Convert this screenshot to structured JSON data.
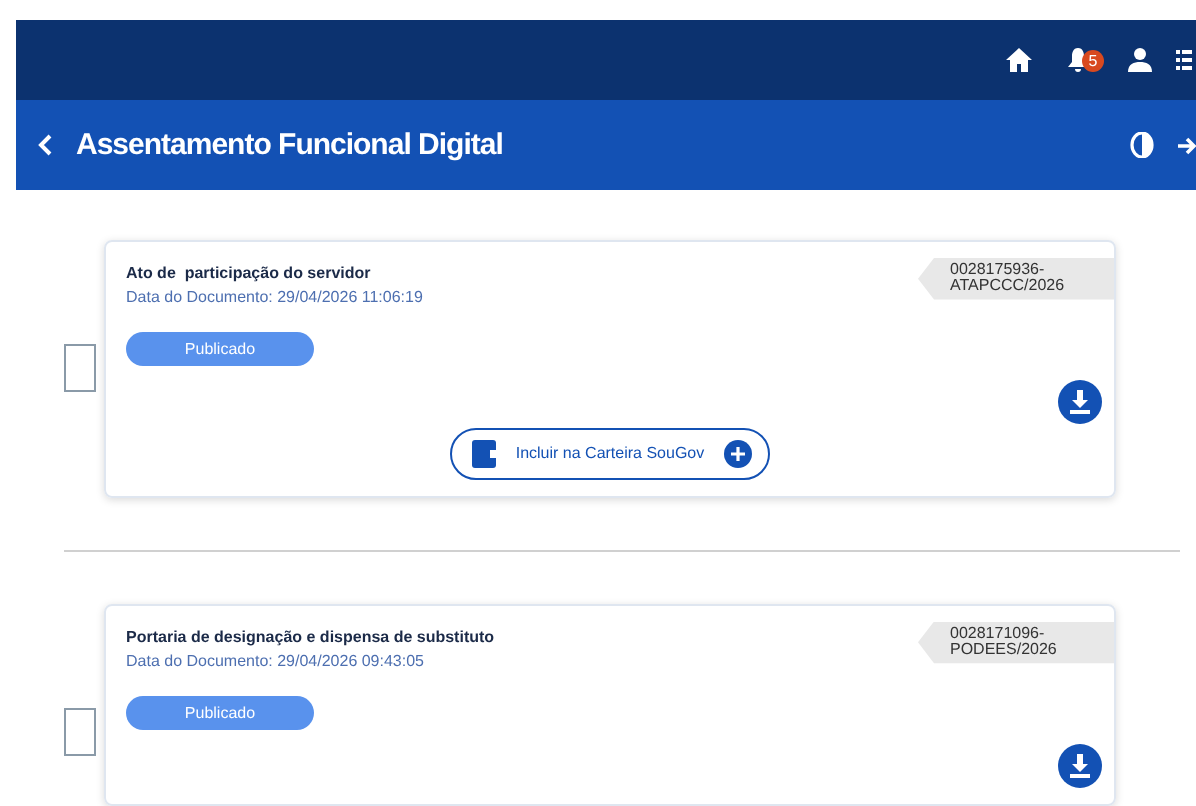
{
  "header": {
    "notifications": "5"
  },
  "page_bar": {
    "title": "Assentamento Funcional Digital"
  },
  "documents": [
    {
      "title": "Ato de  participação do servidor",
      "date": "Data do Documento: 29/04/2026 11:06:19",
      "status": "Publicado",
      "code": "0028175936-\nATAPCCC/2026",
      "checked": false,
      "wallet_button": "Incluir na Carteira SouGov"
    },
    {
      "title": "Portaria de designação e dispensa de substituto",
      "date": "Data do Documento: 29/04/2026 09:43:05",
      "status": "Publicado",
      "code": "0028171096-\nPODEES/2026",
      "checked": false
    }
  ]
}
